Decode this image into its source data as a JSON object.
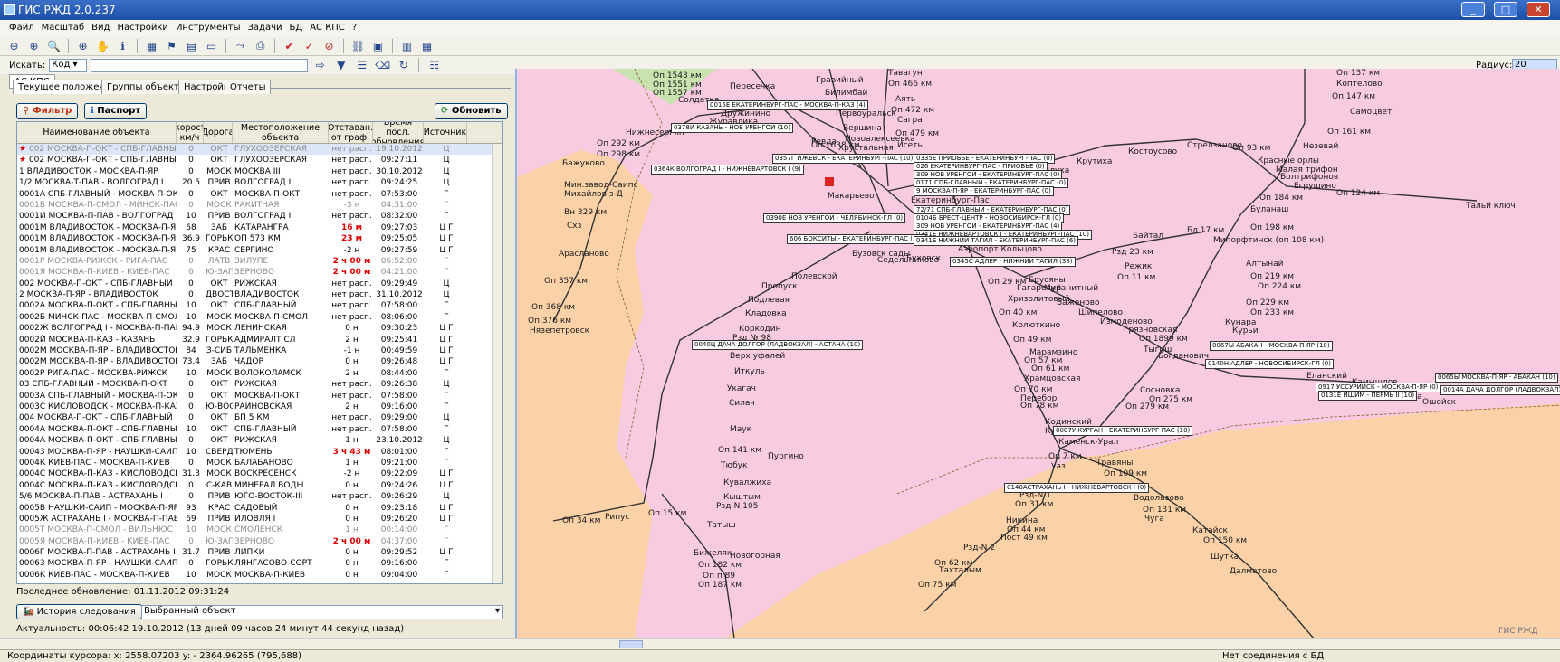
{
  "window": {
    "title": "ГИС РЖД 2.0.237"
  },
  "menu": [
    "Файл",
    "Масштаб",
    "Вид",
    "Настройки",
    "Инструменты",
    "Задачи",
    "БД",
    "АС КПС",
    "?"
  ],
  "search": {
    "label": "Искать:",
    "mode": "Код",
    "value": "",
    "radius_label": "Радиус:",
    "radius_value": "20"
  },
  "left": {
    "top_tab": "АС КПС",
    "tabs": [
      "Текущее положение",
      "Группы объектов",
      "Настройки",
      "Отчеты"
    ],
    "filter_label": "Фильтр",
    "passport_label": "Паспорт",
    "refresh_label": "Обновить",
    "columns": [
      "Наименование объекта",
      "Скорость км/ч",
      "Дорога",
      "Местоположение объекта",
      "Отставан. от граф.",
      "Время посл. обновления",
      "Источник"
    ],
    "rows": [
      [
        "002 МОСКВА-П-ОКТ - СПБ-ГЛАВНЫ",
        "0",
        "ОКТ",
        "ГЛУХООЗЕРСКАЯ",
        "нет расп.",
        "19.10.2012",
        "Ц",
        "grey-flag"
      ],
      [
        "002 МОСКВА-П-ОКТ - СПБ-ГЛАВНЫ",
        "0",
        "ОКТ",
        "ГЛУХООЗЕРСКАЯ",
        "нет расп.",
        "09:27:11",
        "Ц",
        "flag"
      ],
      [
        "1 ВЛАДИВОСТОК - МОСКВА-П-ЯР",
        "0",
        "МОСК",
        "МОСКВА III",
        "нет расп.",
        "30.10.2012",
        "Ц",
        ""
      ],
      [
        "1/2 МОСКВА-Т-ПАВ - ВОЛГОГРАД I",
        "20.5",
        "ПРИВ",
        "ВОЛГОГРАД II",
        "нет расп.",
        "09:24:25",
        "Ц",
        ""
      ],
      [
        "0001А СПБ-ГЛАВНЫЙ - МОСКВА-П-ОКТ",
        "0",
        "ОКТ",
        "МОСКВА-П-ОКТ",
        "нет расп.",
        "07:53:00",
        "Г",
        ""
      ],
      [
        "0001Б МОСКВА-П-СМОЛ - МИНСК-ПАС",
        "0",
        "МОСК",
        "РАКИТНАЯ",
        "-3 н",
        "04:31:00",
        "Г",
        "grey"
      ],
      [
        "0001И МОСКВА-П-ПАВ - ВОЛГОГРАД I",
        "10",
        "ПРИВ",
        "ВОЛГОГРАД I",
        "нет расп.",
        "08:32:00",
        "Г",
        ""
      ],
      [
        "0001М ВЛАДИВОСТОК - МОСКВА-П-ЯР",
        "68",
        "ЗАБ",
        "КАТАРАНГРА",
        "16 м",
        "09:27:03",
        "Ц Г",
        "red"
      ],
      [
        "0001М ВЛАДИВОСТОК - МОСКВА-П-ЯР",
        "36.9",
        "ГОРЬК",
        "ОП 573 КМ",
        "23 м",
        "09:25:05",
        "Ц Г",
        "red"
      ],
      [
        "0001М ВЛАДИВОСТОК - МОСКВА-П-ЯР",
        "75",
        "КРАС",
        "СЕРГИНО",
        "-2 н",
        "09:27:59",
        "Ц Г",
        ""
      ],
      [
        "0001Р МОСКВА-РИЖСК - РИГА-ПАС",
        "0",
        "ЛАТВ",
        "ЗИЛУПЕ",
        "2 ч 00 м",
        "06:52:00",
        "Г",
        "grey-red"
      ],
      [
        "0001Я МОСКВА-П-КИЕВ - КИЕВ-ПАС",
        "0",
        "Ю-ЗАП",
        "ЗЕРНОВО",
        "2 ч 00 м",
        "04:21:00",
        "Г",
        "grey-red"
      ],
      [
        "002 МОСКВА-П-ОКТ - СПБ-ГЛАВНЫЙ",
        "0",
        "ОКТ",
        "РИЖСКАЯ",
        "нет расп.",
        "09:29:49",
        "Ц",
        ""
      ],
      [
        "2 МОСКВА-П-ЯР - ВЛАДИВОСТОК",
        "0",
        "ДВОСТ",
        "ВЛАДИВОСТОК",
        "нет расп.",
        "31.10.2012",
        "Ц",
        ""
      ],
      [
        "0002А МОСКВА-П-ОКТ - СПБ-ГЛАВНЫ",
        "10",
        "ОКТ",
        "СПБ-ГЛАВНЫЙ",
        "нет расп.",
        "07:58:00",
        "Г",
        ""
      ],
      [
        "0002Б МИНСК-ПАС - МОСКВА-П-СМОЛ",
        "10",
        "МОСК",
        "МОСКВА-П-СМОЛ",
        "нет расп.",
        "08:06:00",
        "Г",
        ""
      ],
      [
        "0002Ж ВОЛГОГРАД I - МОСКВА-П-ПАВ",
        "94.9",
        "МОСК",
        "ЛЕНИНСКАЯ",
        "0 н",
        "09:30:23",
        "Ц Г",
        ""
      ],
      [
        "0002Й МОСКВА-П-КАЗ - КАЗАНЬ",
        "32.9",
        "ГОРЬК",
        "АДМИРАЛТ СЛ",
        "2 н",
        "09:25:41",
        "Ц Г",
        ""
      ],
      [
        "0002М МОСКВА-П-ЯР - ВЛАДИВОСТОК",
        "84",
        "З-СИБ",
        "ТАЛЬМЕНКА",
        "-1 н",
        "00:49:59",
        "Ц Г",
        ""
      ],
      [
        "0002М МОСКВА-П-ЯР - ВЛАДИВОСТОК",
        "73.4",
        "ЗАБ",
        "ЧАДОР",
        "0 н",
        "09:26:48",
        "Ц Г",
        ""
      ],
      [
        "0002Р РИГА-ПАС - МОСКВА-РИЖСК",
        "10",
        "МОСК",
        "ВОЛОКОЛАМСК",
        "2 н",
        "08:44:00",
        "Г",
        ""
      ],
      [
        "03 СПБ-ГЛАВНЫЙ - МОСКВА-П-ОКТ",
        "0",
        "ОКТ",
        "РИЖСКАЯ",
        "нет расп.",
        "09:26:38",
        "Ц",
        ""
      ],
      [
        "0003А СПБ-ГЛАВНЫЙ - МОСКВА-П-ОК",
        "0",
        "ОКТ",
        "МОСКВА-П-ОКТ",
        "нет расп.",
        "07:58:00",
        "Г",
        ""
      ],
      [
        "0003С КИСЛОВОДСК - МОСКВА-П-КАЗ",
        "0",
        "Ю-ВОСТ",
        "РАЙНОВСКАЯ",
        "2 н",
        "09:16:00",
        "Г",
        ""
      ],
      [
        "004 МОСКВА-П-ОКТ - СПБ-ГЛАВНЫЙ",
        "0",
        "ОКТ",
        "БП 5 КМ",
        "нет расп.",
        "09:29:00",
        "Ц",
        ""
      ],
      [
        "0004А МОСКВА-П-ОКТ - СПБ-ГЛАВНЫ",
        "10",
        "ОКТ",
        "СПБ-ГЛАВНЫЙ",
        "нет расп.",
        "07:58:00",
        "Г",
        ""
      ],
      [
        "0004А МОСКВА-П-ОКТ - СПБ-ГЛАВНЫ",
        "0",
        "ОКТ",
        "РИЖСКАЯ",
        "1 н",
        "23.10.2012",
        "Ц",
        ""
      ],
      [
        "00043 МОСКВА-П-ЯР - НАУШКИ-САИП",
        "10",
        "СВЕРД",
        "ТЮМЕНЬ",
        "3 ч 43 м",
        "08:01:00",
        "Г",
        "red"
      ],
      [
        "0004К КИЕВ-ПАС - МОСКВА-П-КИЕВ",
        "0",
        "МОСК",
        "БАЛАБАНОВО",
        "1 н",
        "09:21:00",
        "Г",
        ""
      ],
      [
        "0004С МОСКВА-П-КАЗ - КИСЛОВОДСК",
        "31.3",
        "МОСК",
        "ВОСКРЕСЕНСК",
        "-2 н",
        "09:22:09",
        "Ц Г",
        ""
      ],
      [
        "0004С МОСКВА-П-КАЗ - КИСЛОВОДСК",
        "0",
        "С-КАВ",
        "МИНЕРАЛ ВОДЫ",
        "0 н",
        "09:24:26",
        "Ц Г",
        ""
      ],
      [
        "5/6 МОСКВА-П-ПАВ - АСТРАХАНЬ I",
        "0",
        "ПРИВ",
        "ЮГО-ВОСТОК-III",
        "нет расп.",
        "09:26:29",
        "Ц",
        ""
      ],
      [
        "0005В НАУШКИ-САИП - МОСКВА-П-ЯР",
        "93",
        "КРАС",
        "САДОВЫЙ",
        "0 н",
        "09:23:18",
        "Ц Г",
        ""
      ],
      [
        "0005Ж АСТРАХАНЬ I - МОСКВА-П-ПАВ",
        "69",
        "ПРИВ",
        "ИЛОВЛЯ I",
        "0 н",
        "09:26:20",
        "Ц Г",
        ""
      ],
      [
        "0005Т МОСКВА-П-СМОЛ - ВИЛЬНЮС",
        "10",
        "МОСК",
        "СМОЛЕНСК",
        "1 н",
        "00:14:00",
        "Г",
        "grey"
      ],
      [
        "0005Я МОСКВА-П-КИЕВ - КИЕВ-ПАС",
        "0",
        "Ю-ЗАП",
        "ЗЕРНОВО",
        "2 ч 00 м",
        "04:37:00",
        "Г",
        "grey-red"
      ],
      [
        "0006Г МОСКВА-П-ПАВ - АСТРАХАНЬ I",
        "31.7",
        "ПРИВ",
        "ЛИПКИ",
        "0 н",
        "09:29:52",
        "Ц Г",
        ""
      ],
      [
        "00063 МОСКВА-П-ЯР - НАУШКИ-САИП",
        "0",
        "ГОРЬК",
        "ЛЯНГАСОВО-СОРТ",
        "0 н",
        "09:16:00",
        "Г",
        ""
      ],
      [
        "0006К КИЕВ-ПАС - МОСКВА-П-КИЕВ",
        "10",
        "МОСК",
        "МОСКВА-П-КИЕВ",
        "0 н",
        "09:04:00",
        "Г",
        ""
      ]
    ],
    "last_update": "Последнее обновление: 01.11.2012 09:31:24",
    "history_label": "История следования",
    "selected_object": "Выбранный объект",
    "actuality": "Актуальность: 00:06:42 19.10.2012 (13 дней 09 часов 24 минут 44 секунд назад)"
  },
  "map": {
    "labels": [
      [
        "Оп 1543 км",
        150,
        0
      ],
      [
        "Оп 1551 км",
        150,
        10
      ],
      [
        "Оп 1557 км",
        150,
        19
      ],
      [
        "Пересечка",
        235,
        12
      ],
      [
        "Солдатка",
        178,
        27
      ],
      [
        "Дружинино",
        225,
        42
      ],
      [
        "Журавлика",
        212,
        51
      ],
      [
        "Гравийный",
        330,
        5
      ],
      [
        "Билимбай",
        340,
        19
      ],
      [
        "Первоуральск",
        352,
        42
      ],
      [
        "Вершина",
        360,
        58
      ],
      [
        "Новоалексеевка",
        362,
        70
      ],
      [
        "Хрустальная",
        355,
        80
      ],
      [
        "Ревда",
        325,
        73
      ],
      [
        "Нижнесергин",
        120,
        63
      ],
      [
        "Оп 292 км",
        88,
        75
      ],
      [
        "Оп 298 км",
        88,
        87
      ],
      [
        "Бажуково",
        50,
        97
      ],
      [
        "Мин.завод-Саипс",
        52,
        121
      ],
      [
        "Михайлов з-Д",
        52,
        131
      ],
      [
        "Вн 329 км",
        52,
        151
      ],
      [
        "Схз",
        55,
        166
      ],
      [
        "Арасланово",
        46,
        197
      ],
      [
        "Оп 357 км",
        30,
        227
      ],
      [
        "Оп 368 км",
        16,
        256
      ],
      [
        "Оп 376 км",
        12,
        271
      ],
      [
        "Нязепетровск",
        14,
        282
      ],
      [
        "Полевской",
        303,
        222
      ],
      [
        "Пропуск",
        270,
        233
      ],
      [
        "Подлевая",
        255,
        248
      ],
      [
        "Кладовка",
        252,
        263
      ],
      [
        "Коркодин",
        245,
        280
      ],
      [
        "Рзд № 98",
        238,
        290
      ],
      [
        "Верх уфалей",
        235,
        310
      ],
      [
        "Иткуль",
        240,
        327
      ],
      [
        "Укагач",
        232,
        346
      ],
      [
        "Силач",
        234,
        362
      ],
      [
        "Маук",
        235,
        391
      ],
      [
        "Оп 141 км",
        222,
        414
      ],
      [
        "Пургино",
        277,
        421
      ],
      [
        "Тюбук",
        225,
        431
      ],
      [
        "Кувалжиха",
        228,
        450
      ],
      [
        "Кыштым",
        228,
        466
      ],
      [
        "Рзд-N 105",
        220,
        476
      ],
      [
        "Татыш",
        210,
        497
      ],
      [
        "Рипус",
        97,
        488
      ],
      [
        "Оп 15 км",
        145,
        484
      ],
      [
        "Оп 34 км",
        50,
        492
      ],
      [
        "Бижеляк",
        195,
        528
      ],
      [
        "Новогорная",
        235,
        531
      ],
      [
        "Оп 182 км",
        200,
        541
      ],
      [
        "Оп п 89",
        205,
        553
      ],
      [
        "Оп 187 км",
        200,
        563
      ],
      [
        "Тавагун",
        410,
        -3
      ],
      [
        "Оп 466 км",
        410,
        9
      ],
      [
        "Аять",
        418,
        26
      ],
      [
        "Оп 472 км",
        413,
        38
      ],
      [
        "Сагра",
        420,
        49
      ],
      [
        "Оп 479 км",
        418,
        64
      ],
      [
        "Исеть",
        420,
        77
      ],
      [
        "Оп 1638 км",
        325,
        77
      ],
      [
        "Макарьево",
        343,
        133
      ],
      [
        "Екатеринбург-Пас",
        435,
        138
      ],
      [
        "Буховск",
        430,
        202
      ],
      [
        "Бузовск сады",
        370,
        197
      ],
      [
        "Седельниково",
        398,
        204
      ],
      [
        "Аэропорт Кольцово",
        487,
        192
      ],
      [
        "Оп 29 км",
        520,
        228
      ],
      [
        "Брусяны",
        565,
        226
      ],
      [
        "Гагарский",
        552,
        235
      ],
      [
        "Муранитный",
        582,
        235
      ],
      [
        "Хризолитовый",
        542,
        247
      ],
      [
        "Баженово",
        596,
        251
      ],
      [
        "Шипелово",
        620,
        262
      ],
      [
        "Оп 40 км",
        532,
        262
      ],
      [
        "Колюткино",
        547,
        276
      ],
      [
        "Измоденово",
        644,
        272
      ],
      [
        "Грязновская",
        670,
        281
      ],
      [
        "Оп 1899 км",
        687,
        291
      ],
      [
        "Оп 49 км",
        548,
        292
      ],
      [
        "Марамзино",
        566,
        306
      ],
      [
        "Оп 57 км",
        560,
        315
      ],
      [
        "Оп 61 км",
        568,
        324
      ],
      [
        "Храмцовская",
        560,
        335
      ],
      [
        "Оп 70 км",
        549,
        347
      ],
      [
        "Перебор",
        556,
        357
      ],
      [
        "Оп 78 км",
        556,
        365
      ],
      [
        "Кодинский",
        583,
        383
      ],
      [
        "Кунара",
        583,
        393
      ],
      [
        "Каменск-Урал",
        598,
        405
      ],
      [
        "Оп 7 км",
        587,
        421
      ],
      [
        "Травяны",
        640,
        428
      ],
      [
        "Уаз",
        590,
        432
      ],
      [
        "Оп 109 км",
        648,
        440
      ],
      [
        "Рзд-N 1",
        555,
        464
      ],
      [
        "Оп 31 км",
        550,
        474
      ],
      [
        "Водолазово",
        681,
        467
      ],
      [
        "Оп 131 км",
        691,
        480
      ],
      [
        "Чуга",
        693,
        490
      ],
      [
        "Никина",
        540,
        492
      ],
      [
        "Оп 44 км",
        541,
        502
      ],
      [
        "Пост 49 км",
        534,
        511
      ],
      [
        "Катайск",
        746,
        503
      ],
      [
        "Оп 150 км",
        758,
        514
      ],
      [
        "Шутка",
        766,
        532
      ],
      [
        "Далматово",
        787,
        548
      ],
      [
        "Рзд-N 2",
        493,
        522
      ],
      [
        "Оп 62 км",
        461,
        539
      ],
      [
        "Тахталым",
        466,
        547
      ],
      [
        "Оп 75 км",
        443,
        563
      ],
      [
        "Сосновка",
        688,
        348
      ],
      [
        "Оп 275 км",
        698,
        358
      ],
      [
        "Оп 279 км",
        672,
        366
      ],
      [
        "Богданович",
        708,
        310
      ],
      [
        "Тыгиш",
        692,
        303
      ],
      [
        "Копалуха",
        565,
        105
      ],
      [
        "Крутиха",
        618,
        95
      ],
      [
        "Костоусово",
        675,
        84
      ],
      [
        "Стрелзаново",
        740,
        77
      ],
      [
        "Оп 93 км",
        790,
        80
      ],
      [
        "Красные орлы",
        818,
        94
      ],
      [
        "Малая трифон",
        838,
        104
      ],
      [
        "Болтрифонов",
        843,
        112
      ],
      [
        "Егрушино",
        858,
        122
      ],
      [
        "Оп 184 км",
        820,
        135
      ],
      [
        "Оп 124 км",
        905,
        130
      ],
      [
        "Буланаш",
        810,
        148
      ],
      [
        "Оп 198 км",
        810,
        168
      ],
      [
        "Байтал",
        680,
        177
      ],
      [
        "Бл 17 км",
        740,
        171
      ],
      [
        "Мипорфтинск (оп 108 км)",
        769,
        182
      ],
      [
        "Рзд 23 км",
        657,
        195
      ],
      [
        "Режик",
        671,
        211
      ],
      [
        "Оп 11 км",
        663,
        223
      ],
      [
        "Алтынай",
        805,
        208
      ],
      [
        "Оп 219 км",
        810,
        222
      ],
      [
        "Оп 224 км",
        818,
        233
      ],
      [
        "Оп 229 км",
        805,
        251
      ],
      [
        "Оп 233 км",
        810,
        262
      ],
      [
        "Кунара",
        782,
        273
      ],
      [
        "Курьи",
        790,
        282
      ],
      [
        "Еланский",
        872,
        332
      ],
      [
        "Камышлов",
        922,
        339
      ],
      [
        "Акрапка",
        960,
        355
      ],
      [
        "Ошейск",
        1000,
        361
      ],
      [
        "Оп 137 км",
        905,
        -3
      ],
      [
        "Коптелово",
        905,
        9
      ],
      [
        "Оп 147 км",
        900,
        23
      ],
      [
        "Самоцвет",
        920,
        40
      ],
      [
        "Оп 161 км",
        895,
        62
      ],
      [
        "Незевай",
        868,
        78
      ],
      [
        "Тальй ключ",
        1048,
        144
      ]
    ],
    "boxes": [
      [
        "0015Е ЕКАТЕРИНБУРГ-ПАС - МОСКВА-П-КАЗ (4)",
        210,
        32
      ],
      [
        "0378Й КАЗАНЬ - НОВ УРЕНГОЙ (10)",
        170,
        57
      ],
      [
        "0357Г ИЖЕВСК - ЕКАТЕРИНБУРГ-ПАС (10)",
        282,
        91
      ],
      [
        "0364К ВОЛГОГРАД I - НИЖНЕВАРТОВСК I (9)",
        148,
        103
      ],
      [
        "0335Е ПРИОБЬЕ - ЕКАТЕРИНБУРГ-ПАС (0)",
        438,
        91
      ],
      [
        "026 ЕКАТЕРИНБУРГ-ПАС - ПРИОБЬЕ (0)",
        438,
        100
      ],
      [
        "309 НОВ УРЕНГОЙ - ЕКАТЕРИНБУРГ-ПАС (0)",
        438,
        109
      ],
      [
        "0171 СПБ-ГЛАВНЫЙ - ЕКАТЕРИНБУРГ-ПАС (0)",
        438,
        118
      ],
      [
        "9 МОСКВА-П-ЯР - ЕКАТЕРИНБУРГ-ПАС (0)",
        438,
        127
      ],
      [
        "72/71 СПБ-ГЛАВНЫЙ - ЕКАТЕРИНБУРГ-ПАС (0)",
        438,
        148
      ],
      [
        "0104Б БРЕСТ-ЦЕНТР - НОВОСИБИРСК-ГЛ (0)",
        438,
        157
      ],
      [
        "0390Е НОВ УРЕНГОЙ - ЧЕЛЯБИНСК-ГЛ (0)",
        272,
        157
      ],
      [
        "309 НОВ УРЕНГОЙ - ЕКАТЕРИНБУРГ-ПАС (4)",
        438,
        166
      ],
      [
        "0341Е НИЖНЕВАРТОВСК I - ЕКАТЕРИНБУРГ-ПАС (10)",
        438,
        175
      ],
      [
        "606 БОКСИТЫ - ЕКАТЕРИНБУРГ-ПАС (10)",
        298,
        180
      ],
      [
        "0341Е НИЖНИЙ ТАГИЛ - ЕКАТЕРИНБУРГ-ПАС (6)",
        438,
        182
      ],
      [
        "0345С АДЛЕР - НИЖНИЙ ТАГИЛ (38)",
        478,
        205
      ],
      [
        "0040Ц ДАЧА ДОЛГОР (ЛАДВОКЗАЛ) - АСТАНА (10)",
        193,
        297
      ],
      [
        "0067Ы АБАКАН - МОСКВА-П-ЯР (10)",
        765,
        298
      ],
      [
        "0140Н АДЛЕР - НОВОСИБИРСК-ГЛ (0)",
        760,
        318
      ],
      [
        "0065Ы МОСКВА-П-ЯР - АБАКАН (10)",
        1014,
        333
      ],
      [
        "0917 УССУРИЙСК - МОСКВА-П-ЯР (0)",
        882,
        344
      ],
      [
        "0131Е ИШИМ - ПЕРМЬ II (10)",
        885,
        353
      ],
      [
        "0014А ДАЧА ДОЛГОР (ЛАДВОКЗАЛ)",
        1020,
        347
      ],
      [
        "0007У КУРГАН - ЕКАТЕРИНБУРГ-ПАС (10)",
        592,
        392
      ],
      [
        "0140АСТРАХАНЬ I - НИЖНЕВАРТОВСК I (0)",
        538,
        455
      ]
    ],
    "watermark": "ГИС РЖД"
  },
  "status": {
    "cursor": "Координаты курсора: x:    2558.07203 y: -    2364.96265 (795,688)",
    "connection": "Нет соединения с БД"
  }
}
